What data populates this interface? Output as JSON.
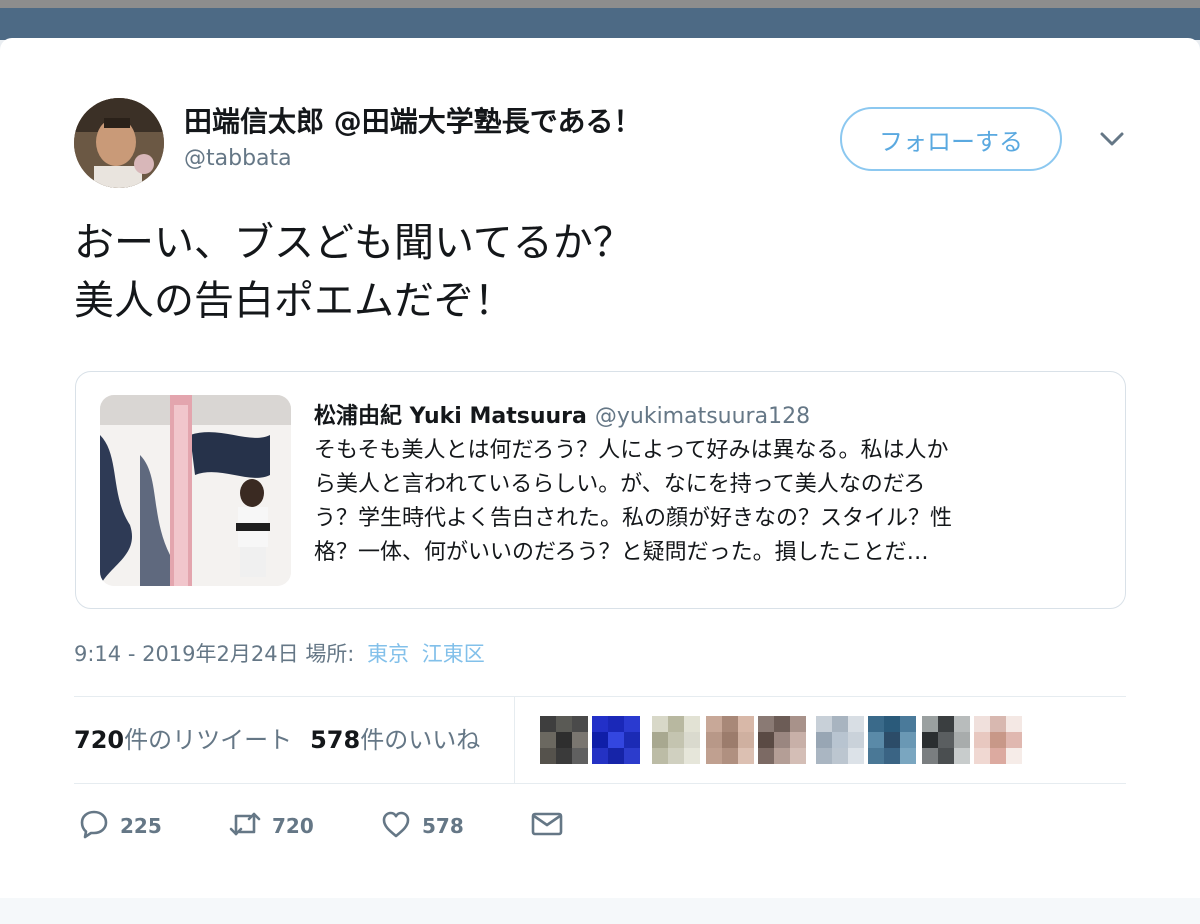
{
  "tweet": {
    "author_name": "田端信太郎 @田端大学塾長である！",
    "author_handle": "@tabbata",
    "follow_label": "フォローする",
    "text_lines": [
      "おーい、ブスども聞いてるか？",
      "美人の告白ポエムだぞ！"
    ],
    "quoted": {
      "author_name": "松浦由紀 Yuki Matsuura",
      "author_handle": "@yukimatsuura128",
      "text_lines": [
        "そもそも美人とは何だろう？人によって好みは異なる。私は人か",
        "ら美人と言われているらしい。が、なにを持って美人なのだろ",
        "う？学生時代よく告白された。私の顔が好きなの？スタイル？性",
        "格？一体、何がいいのだろう？と疑問だった。損したことだ…"
      ]
    },
    "timestamp": "9:14 - 2019年2月24日",
    "location_label": "場所:",
    "location_links": [
      "東京",
      "江東区"
    ],
    "stats": {
      "retweet_count": "720",
      "retweet_label": "件のリツイート",
      "like_count": "578",
      "like_label": "件のいいね"
    },
    "actions": {
      "reply_count": "225",
      "retweet_count": "720",
      "like_count": "578"
    }
  },
  "icons": {
    "caret": "chevron-down-icon",
    "reply": "reply-icon",
    "retweet": "retweet-icon",
    "like": "heart-icon",
    "dm": "envelope-icon"
  },
  "colors": {
    "accent": "#1da1f2",
    "follow_border": "#8cc8f0",
    "link": "#82c0ea",
    "muted": "#657786"
  }
}
